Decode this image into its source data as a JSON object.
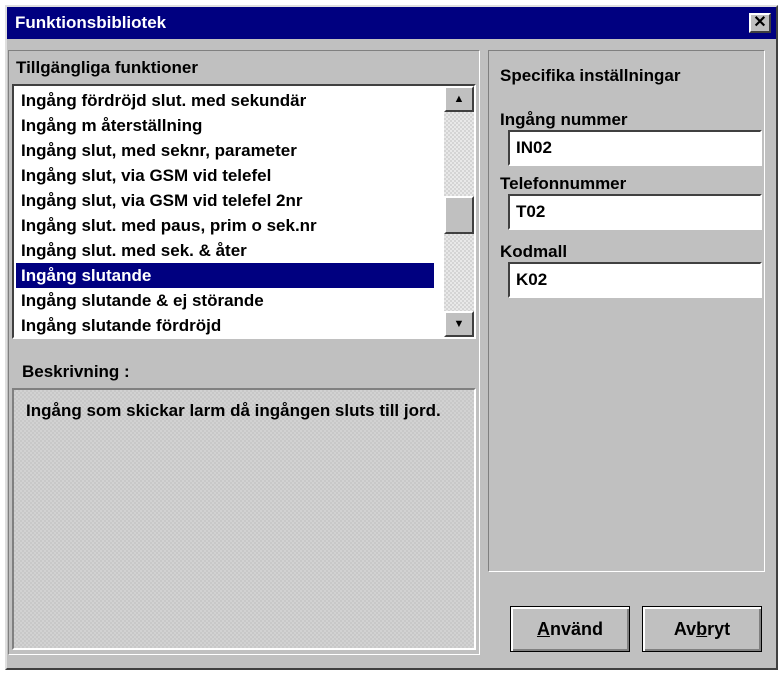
{
  "window": {
    "title": "Funktionsbibliotek",
    "close_glyph": "✕"
  },
  "functions": {
    "label": "Tillgängliga funktioner",
    "items": [
      "Ingång fördröjd slut. med sekundär",
      "Ingång m återställning",
      "Ingång slut, med seknr, parameter",
      "Ingång slut, via GSM vid telefel",
      "Ingång slut, via GSM vid telefel 2nr",
      "Ingång slut. med paus, prim o sek.nr",
      "Ingång slut. med sek. & åter",
      "Ingång slutande",
      "Ingång slutande & ej störande",
      "Ingång slutande fördröjd"
    ],
    "selected_index": 7
  },
  "description": {
    "label": "Beskrivning :",
    "text": "Ingång som skickar larm då ingången sluts till jord."
  },
  "settings": {
    "label": "Specifika inställningar",
    "input_number_label": "Ingång nummer",
    "input_number_value": "IN02",
    "phone_label": "Telefonnummer",
    "phone_value": "T02",
    "code_label": "Kodmall",
    "code_value": "K02"
  },
  "buttons": {
    "apply": {
      "pre": "",
      "accel": "A",
      "post": "nvänd"
    },
    "cancel": {
      "pre": "Av",
      "accel": "b",
      "post": "ryt"
    }
  }
}
